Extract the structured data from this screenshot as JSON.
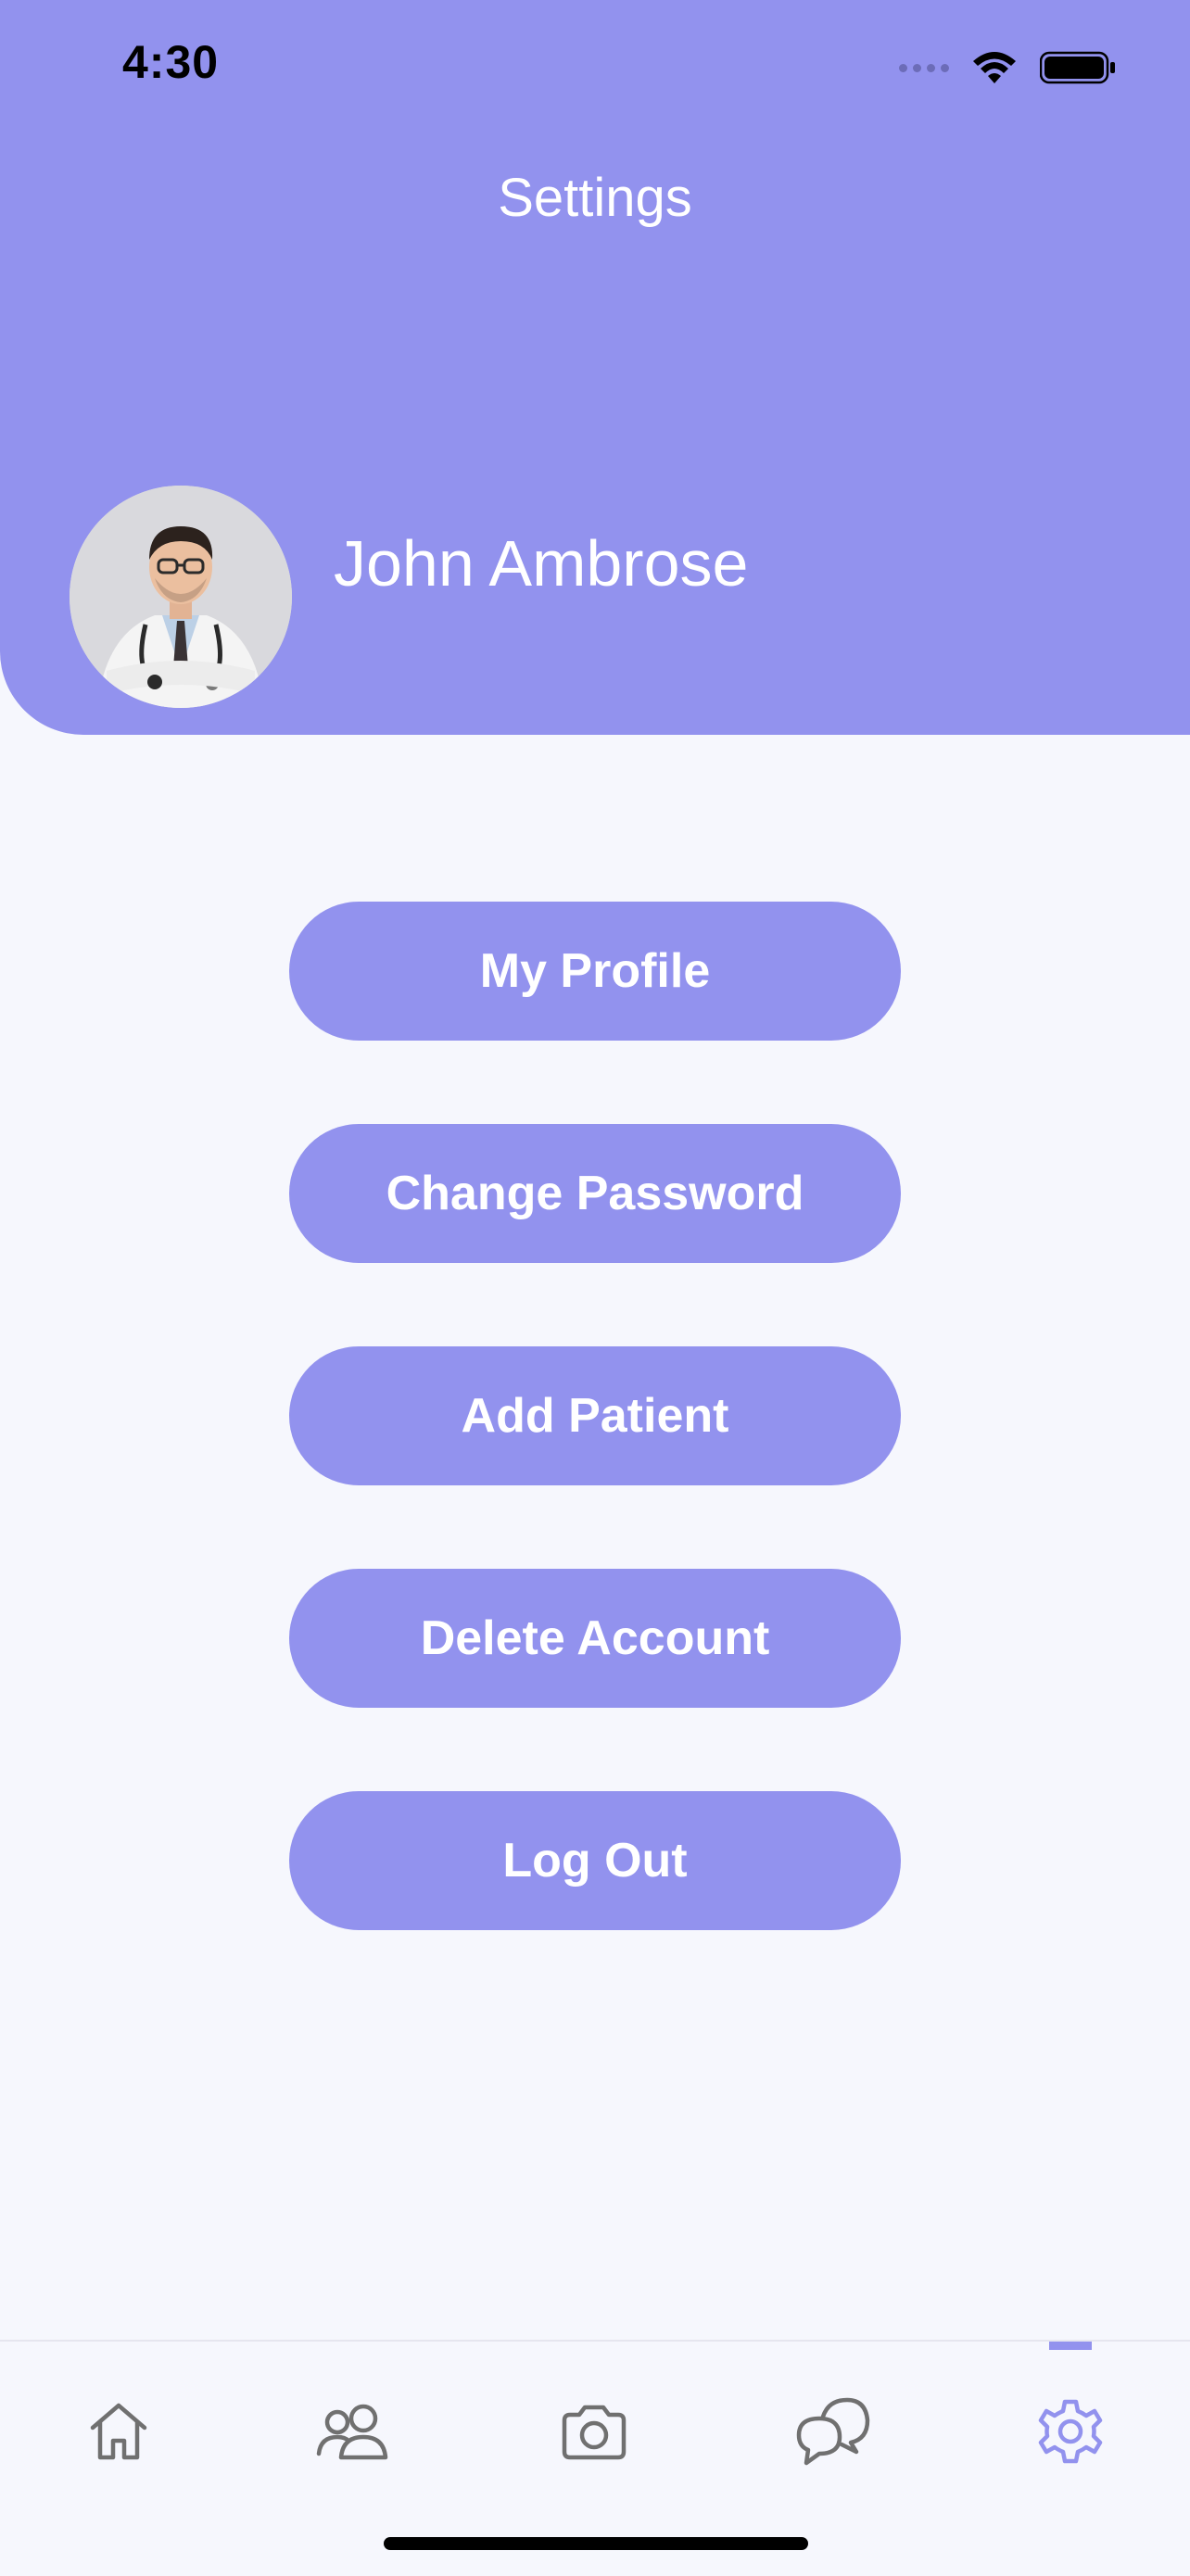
{
  "status_bar": {
    "time": "4:30"
  },
  "header": {
    "title": "Settings"
  },
  "profile": {
    "name": "John Ambrose"
  },
  "menu": {
    "my_profile": "My Profile",
    "change_password": "Change Password",
    "add_patient": "Add Patient",
    "delete_account": "Delete Account",
    "log_out": "Log Out"
  },
  "tabs": [
    {
      "icon": "home-icon",
      "active": false
    },
    {
      "icon": "users-icon",
      "active": false
    },
    {
      "icon": "camera-icon",
      "active": false
    },
    {
      "icon": "chat-icon",
      "active": false
    },
    {
      "icon": "gear-icon",
      "active": true
    }
  ],
  "colors": {
    "accent": "#9292ee",
    "background": "#f6f7fd",
    "inactive_icon": "#707070"
  }
}
